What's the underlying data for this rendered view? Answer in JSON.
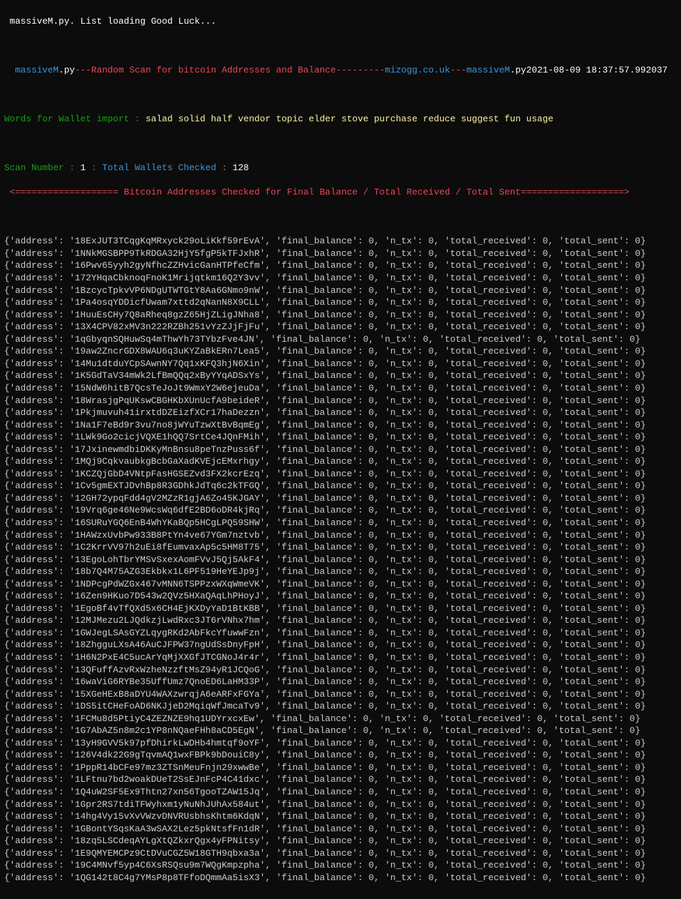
{
  "header": {
    "top_line": " massiveM.py. List loading Good Luck...",
    "banner": {
      "left_space": "  ",
      "script_left": "massiveM",
      "ext_left": ".py",
      "dashes1": "---",
      "title": "Random Scan for bitcoin Addresses and Balance",
      "dashes2": "---------",
      "site": "mizogg.co.uk",
      "dashes3": "---",
      "script_right": "massiveM",
      "ext_right": ".py",
      "timestamp": "2021-08-09 18:37:57.992037"
    },
    "words_label": "Words for Wallet import : ",
    "words_value": "salad solid half vendor topic elder stove purchase reduce suggest fun usage",
    "scan_label1": "Scan Number : ",
    "scan_value": "1",
    "scan_label2": " : ",
    "wallets_label": "Total Wallets Checked : ",
    "wallets_value": "128",
    "divider_left": " <",
    "divider_eq_left": "===================",
    "divider_text": " Bitcoin Addresses Checked for Final Balance / Total Received / Total Sent",
    "divider_eq_right": "===================",
    "divider_right": ">"
  },
  "row_template": {
    "prefix": "{'address': '",
    "after_addr": "', 'final_balance': ",
    "after_fb": ", 'n_tx': ",
    "after_ntx": ", 'total_received': ",
    "after_tr": ", 'total_sent': ",
    "suffix": "}"
  },
  "rows": [
    {
      "address": "18ExJUT3TCqgKqMRxyck29oLiKkf59rEvA",
      "final_balance": 0,
      "n_tx": 0,
      "total_received": 0,
      "total_sent": 0
    },
    {
      "address": "1NNkMGSBPP9TkRDGA32HjY5fgP5kTFJxhR",
      "final_balance": 0,
      "n_tx": 0,
      "total_received": 0,
      "total_sent": 0
    },
    {
      "address": "16Pwv65yyh2gyNfhcZZHvicGanHTPfeCfm",
      "final_balance": 0,
      "n_tx": 0,
      "total_received": 0,
      "total_sent": 0
    },
    {
      "address": "172YHqaCbknoqFnoK1Mrijqtkm16Q2Y3vv",
      "final_balance": 0,
      "n_tx": 0,
      "total_received": 0,
      "total_sent": 0
    },
    {
      "address": "1BzcycTpkvVP6NDgUTWTGtY8Aa6GNmo9nW",
      "final_balance": 0,
      "n_tx": 0,
      "total_received": 0,
      "total_sent": 0
    },
    {
      "address": "1Pa4osqYDDicfUwam7xttd2qNanN8X9CLL",
      "final_balance": 0,
      "n_tx": 0,
      "total_received": 0,
      "total_sent": 0
    },
    {
      "address": "1HuuEsCHy7Q8aRheq8gzZ65HjZLigJNha8",
      "final_balance": 0,
      "n_tx": 0,
      "total_received": 0,
      "total_sent": 0
    },
    {
      "address": "13X4CPV82xMV3n222RZBh251vYzZJjFjFu",
      "final_balance": 0,
      "n_tx": 0,
      "total_received": 0,
      "total_sent": 0
    },
    {
      "address": "1qGbyqnSQHuwSq4mThwYh73TYbzFve4JN",
      "final_balance": 0,
      "n_tx": 0,
      "total_received": 0,
      "total_sent": 0
    },
    {
      "address": "19aw2ZncrGDX8WAU6q3uKYZaBkERn7Lea5",
      "final_balance": 0,
      "n_tx": 0,
      "total_received": 0,
      "total_sent": 0
    },
    {
      "address": "14Mu1dtduYCpSAwnNY7Qq1xKFQ3hjN6Xin",
      "final_balance": 0,
      "n_tx": 0,
      "total_received": 0,
      "total_sent": 0
    },
    {
      "address": "1K5GdTaV34mWk2LfBmQQq2xByYYqADSxYs",
      "final_balance": 0,
      "n_tx": 0,
      "total_received": 0,
      "total_sent": 0
    },
    {
      "address": "15NdW6hitB7QcsTeJoJt9WmxY2W6ejeuDa",
      "final_balance": 0,
      "n_tx": 0,
      "total_received": 0,
      "total_sent": 0
    },
    {
      "address": "18WrasjgPqUKswCBGHKbXUnUcfA9beideR",
      "final_balance": 0,
      "n_tx": 0,
      "total_received": 0,
      "total_sent": 0
    },
    {
      "address": "1Pkjmuvuh41irxtdDZEizfXCr17haDezzn",
      "final_balance": 0,
      "n_tx": 0,
      "total_received": 0,
      "total_sent": 0
    },
    {
      "address": "1Na1F7eBd9r3vu7no8jWYuTzwXtBvBqmEg",
      "final_balance": 0,
      "n_tx": 0,
      "total_received": 0,
      "total_sent": 0
    },
    {
      "address": "1LWk9Go2cicjVQXE1hQQ7SrtCe4JQnFMih",
      "final_balance": 0,
      "n_tx": 0,
      "total_received": 0,
      "total_sent": 0
    },
    {
      "address": "17JxinewmdbiDKKyMnBnsu8peTnzPuss6f",
      "final_balance": 0,
      "n_tx": 0,
      "total_received": 0,
      "total_sent": 0
    },
    {
      "address": "1MQj9CqkvaubkgBcbGaXadKVEjcEMxrhgy",
      "final_balance": 0,
      "n_tx": 0,
      "total_received": 0,
      "total_sent": 0
    },
    {
      "address": "1KCZQjGbD4VNtpFasHGSEZvd3FX2kcrEzq",
      "final_balance": 0,
      "n_tx": 0,
      "total_received": 0,
      "total_sent": 0
    },
    {
      "address": "1Cv5gmEXTJDvhBp8R3GDhkJdTq6c2kTFGQ",
      "final_balance": 0,
      "n_tx": 0,
      "total_received": 0,
      "total_sent": 0
    },
    {
      "address": "12GH72ypqFdd4gV2MZzR1gjA6Zo45KJGAY",
      "final_balance": 0,
      "n_tx": 0,
      "total_received": 0,
      "total_sent": 0
    },
    {
      "address": "19Vrq6ge46Ne9WcsWq6dfE2BD6oDR4kjRq",
      "final_balance": 0,
      "n_tx": 0,
      "total_received": 0,
      "total_sent": 0
    },
    {
      "address": "16SURuYGQ6EnB4WhYKaBQp5HCgLPQ59SHW",
      "final_balance": 0,
      "n_tx": 0,
      "total_received": 0,
      "total_sent": 0
    },
    {
      "address": "1HAWzxUvbPw933B8PtYn4ve67YGm7nztvb",
      "final_balance": 0,
      "n_tx": 0,
      "total_received": 0,
      "total_sent": 0
    },
    {
      "address": "1C2KrrVV97h2uEi8fEumvaxAp5c5HM8T75",
      "final_balance": 0,
      "n_tx": 0,
      "total_received": 0,
      "total_sent": 0
    },
    {
      "address": "13EgoLohTbrYMSvSxexAomFVvJ5Qj5AkF4",
      "final_balance": 0,
      "n_tx": 0,
      "total_received": 0,
      "total_sent": 0
    },
    {
      "address": "18b7Q4M75AZG3Ekbkx1L6PF519HeYEJp9j",
      "final_balance": 0,
      "n_tx": 0,
      "total_received": 0,
      "total_sent": 0
    },
    {
      "address": "1NDPcgPdWZGx467vMNN6TSPPzxWXqWmeVK",
      "final_balance": 0,
      "n_tx": 0,
      "total_received": 0,
      "total_sent": 0
    },
    {
      "address": "16Zen9HKuo7D543w2QVz5HXaQAqLhPHoyJ",
      "final_balance": 0,
      "n_tx": 0,
      "total_received": 0,
      "total_sent": 0
    },
    {
      "address": "1EgoBf4vTfQXd5x6CH4EjKXDyYaD1BtKBB",
      "final_balance": 0,
      "n_tx": 0,
      "total_received": 0,
      "total_sent": 0
    },
    {
      "address": "12MJMezu2LJQdkzjLwdRxc3JT6rVNhx7hm",
      "final_balance": 0,
      "n_tx": 0,
      "total_received": 0,
      "total_sent": 0
    },
    {
      "address": "1GWJegLSAsGYZLqygRKd2AbFkcYfuwwFzn",
      "final_balance": 0,
      "n_tx": 0,
      "total_received": 0,
      "total_sent": 0
    },
    {
      "address": "18ZhgguLXsA46AuCJFPW37ngUdSsDnyFpH",
      "final_balance": 0,
      "n_tx": 0,
      "total_received": 0,
      "total_sent": 0
    },
    {
      "address": "1H6N2PxE4C5ucArYqMjXXGfJTCGNoJ4r4r",
      "final_balance": 0,
      "n_tx": 0,
      "total_received": 0,
      "total_sent": 0
    },
    {
      "address": "13QFuffAzvRxWzheNzzftMsZ94yR1JCQoG",
      "final_balance": 0,
      "n_tx": 0,
      "total_received": 0,
      "total_sent": 0
    },
    {
      "address": "16waViG6RYBe35UffUmz7QnoED6LaHM33P",
      "final_balance": 0,
      "n_tx": 0,
      "total_received": 0,
      "total_sent": 0
    },
    {
      "address": "15XGeHExB8aDYU4WAXzwrqjA6eARFxFGYa",
      "final_balance": 0,
      "n_tx": 0,
      "total_received": 0,
      "total_sent": 0
    },
    {
      "address": "1DS5itCHeFoAD6NKJjeD2MqiqWfJmcaTv9",
      "final_balance": 0,
      "n_tx": 0,
      "total_received": 0,
      "total_sent": 0
    },
    {
      "address": "1FCMu8d5PtiyC4ZEZNZE9hq1UDYrxcxEw",
      "final_balance": 0,
      "n_tx": 0,
      "total_received": 0,
      "total_sent": 0
    },
    {
      "address": "1G7AbAZ5n8m2c1YP8nNQaeFHh8aCD5EgN",
      "final_balance": 0,
      "n_tx": 0,
      "total_received": 0,
      "total_sent": 0
    },
    {
      "address": "13yH9GVV5k97pfDhirkLwDHb4hmtqf9oYF",
      "final_balance": 0,
      "n_tx": 0,
      "total_received": 0,
      "total_sent": 0
    },
    {
      "address": "126V4dk22G9gTqvmAQ1wxFBPk9bDouiC8y",
      "final_balance": 0,
      "n_tx": 0,
      "total_received": 0,
      "total_sent": 0
    },
    {
      "address": "1PppR14bCFe97mz3ZTSnMeuFnjn29xwwBe",
      "final_balance": 0,
      "n_tx": 0,
      "total_received": 0,
      "total_sent": 0
    },
    {
      "address": "1LFtnu7bd2woakDUeT2SsEJnFcP4C41dxc",
      "final_balance": 0,
      "n_tx": 0,
      "total_received": 0,
      "total_sent": 0
    },
    {
      "address": "1Q4uW2SF5Ex9Thtn27xn56TgooTZAW15Jq",
      "final_balance": 0,
      "n_tx": 0,
      "total_received": 0,
      "total_sent": 0
    },
    {
      "address": "1Gpr2RS7tdiTFWyhxm1yNuNhJUhAx584ut",
      "final_balance": 0,
      "n_tx": 0,
      "total_received": 0,
      "total_sent": 0
    },
    {
      "address": "14hg4Vy15vXvVWzvDNVRUsbhsKhtm6KdqN",
      "final_balance": 0,
      "n_tx": 0,
      "total_received": 0,
      "total_sent": 0
    },
    {
      "address": "1GBontYSqsKaA3wSAX2Lez5pkNtsfFn1dR",
      "final_balance": 0,
      "n_tx": 0,
      "total_received": 0,
      "total_sent": 0
    },
    {
      "address": "18zq5LSCdeqAYLgXtQZkxrQgx4yFPNitsy",
      "final_balance": 0,
      "n_tx": 0,
      "total_received": 0,
      "total_sent": 0
    },
    {
      "address": "1E9QMYEMCPz9CtDVuCGZ5W18GTH9qbxa3a",
      "final_balance": 0,
      "n_tx": 0,
      "total_received": 0,
      "total_sent": 0
    },
    {
      "address": "19C4MNvf5yp4C6XsRSQsu9m7WQgKmpzpha",
      "final_balance": 0,
      "n_tx": 0,
      "total_received": 0,
      "total_sent": 0
    },
    {
      "address": "1QG142t8C4g7YMsP8p8TFfoDQmmAa5isX3",
      "final_balance": 0,
      "n_tx": 0,
      "total_received": 0,
      "total_sent": 0
    }
  ]
}
